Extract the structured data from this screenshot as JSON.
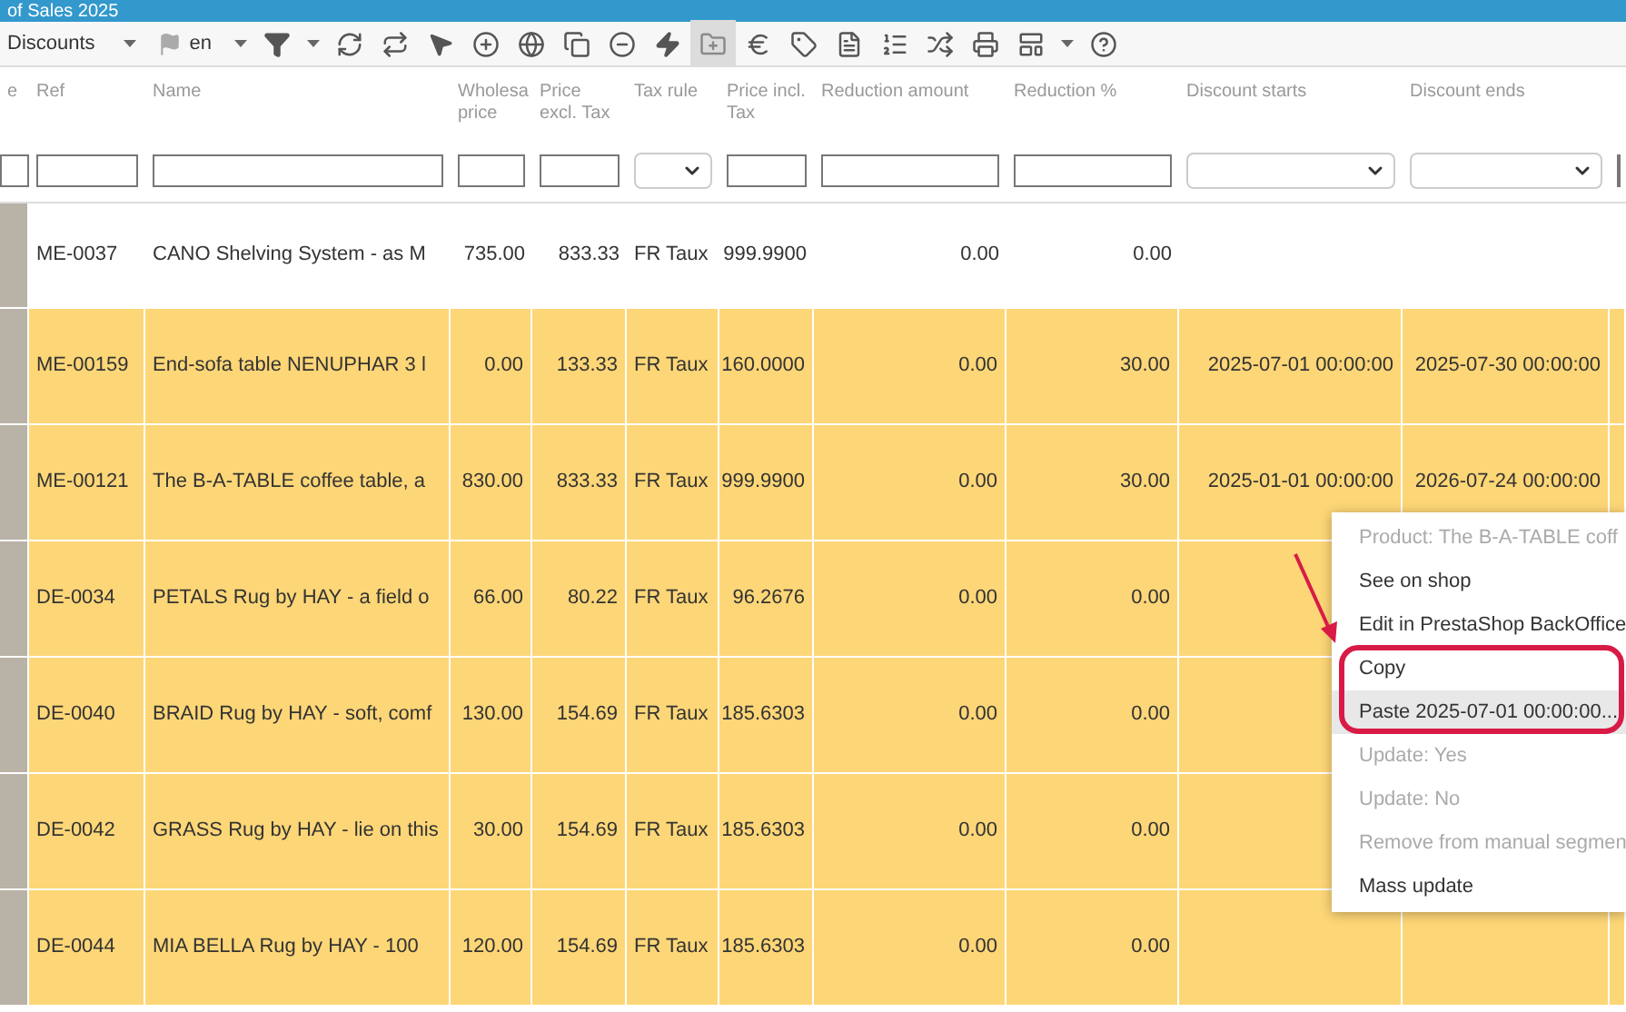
{
  "window": {
    "title": "of Sales 2025"
  },
  "toolbar": {
    "view": "Discounts",
    "language": "en"
  },
  "columns": [
    {
      "label": "e",
      "kind": "image",
      "filter_select": false
    },
    {
      "label": "Ref",
      "kind": "text",
      "filter_select": false
    },
    {
      "label": "Name",
      "kind": "text",
      "filter_select": false
    },
    {
      "label": "Wholesa price",
      "kind": "number",
      "filter_select": false
    },
    {
      "label": "Price excl. Tax",
      "kind": "number",
      "filter_select": false
    },
    {
      "label": "Tax rule",
      "kind": "text",
      "filter_select": true
    },
    {
      "label": "Price incl. Tax",
      "kind": "number",
      "filter_select": false
    },
    {
      "label": "Reduction amount",
      "kind": "number",
      "filter_select": false
    },
    {
      "label": "Reduction %",
      "kind": "number",
      "filter_select": false
    },
    {
      "label": "Discount starts",
      "kind": "number",
      "filter_select": true
    },
    {
      "label": "Discount ends",
      "kind": "number",
      "filter_select": true
    },
    {
      "kind": "text",
      "filter_select": false
    }
  ],
  "rows": [
    {
      "selected": false,
      "cells": [
        "ME-0037",
        "CANO Shelving System - as M",
        "735.00",
        "833.33",
        "FR Taux",
        "999.9900",
        "0.00",
        "0.00"
      ]
    },
    {
      "selected": true,
      "cells": [
        "ME-00159",
        "End-sofa table NENUPHAR 3 l",
        "0.00",
        "133.33",
        "FR Taux",
        "160.0000",
        "0.00",
        "30.00",
        "2025-07-01 00:00:00",
        "2025-07-30 00:00:00"
      ]
    },
    {
      "selected": true,
      "cells": [
        "ME-00121",
        "The B-A-TABLE coffee table, a",
        "830.00",
        "833.33",
        "FR Taux",
        "999.9900",
        "0.00",
        "30.00",
        "2025-01-01 00:00:00",
        "2026-07-24 00:00:00"
      ]
    },
    {
      "selected": true,
      "cells": [
        "DE-0034",
        "PETALS Rug by HAY - a field o",
        "66.00",
        "80.22",
        "FR Taux",
        "96.2676",
        "0.00",
        "0.00"
      ]
    },
    {
      "selected": true,
      "cells": [
        "DE-0040",
        "BRAID Rug by HAY - soft, comf",
        "130.00",
        "154.69",
        "FR Taux",
        "185.6303",
        "0.00",
        "0.00"
      ]
    },
    {
      "selected": true,
      "cells": [
        "DE-0042",
        "GRASS Rug by HAY - lie on this",
        "30.00",
        "154.69",
        "FR Taux",
        "185.6303",
        "0.00",
        "0.00"
      ]
    },
    {
      "selected": true,
      "cells": [
        "DE-0044",
        "MIA BELLA Rug by HAY - 100",
        "120.00",
        "154.69",
        "FR Taux",
        "185.6303",
        "0.00",
        "0.00"
      ]
    }
  ],
  "context_menu": [
    {
      "label": "Product: The B-A-TABLE coff",
      "disabled": true,
      "selected": false
    },
    {
      "label": "See on shop",
      "disabled": false,
      "selected": false
    },
    {
      "label": "Edit in PrestaShop BackOffice",
      "disabled": false,
      "selected": false
    },
    {
      "label": "Copy",
      "disabled": false,
      "selected": false
    },
    {
      "label": "Paste 2025-07-01 00:00:00...",
      "disabled": false,
      "selected": true
    },
    {
      "label": "Update: Yes",
      "disabled": true,
      "selected": false
    },
    {
      "label": "Update: No",
      "disabled": true,
      "selected": false
    },
    {
      "label": "Remove from manual segmen",
      "disabled": true,
      "selected": false
    },
    {
      "label": "Mass update",
      "disabled": false,
      "selected": false
    }
  ]
}
